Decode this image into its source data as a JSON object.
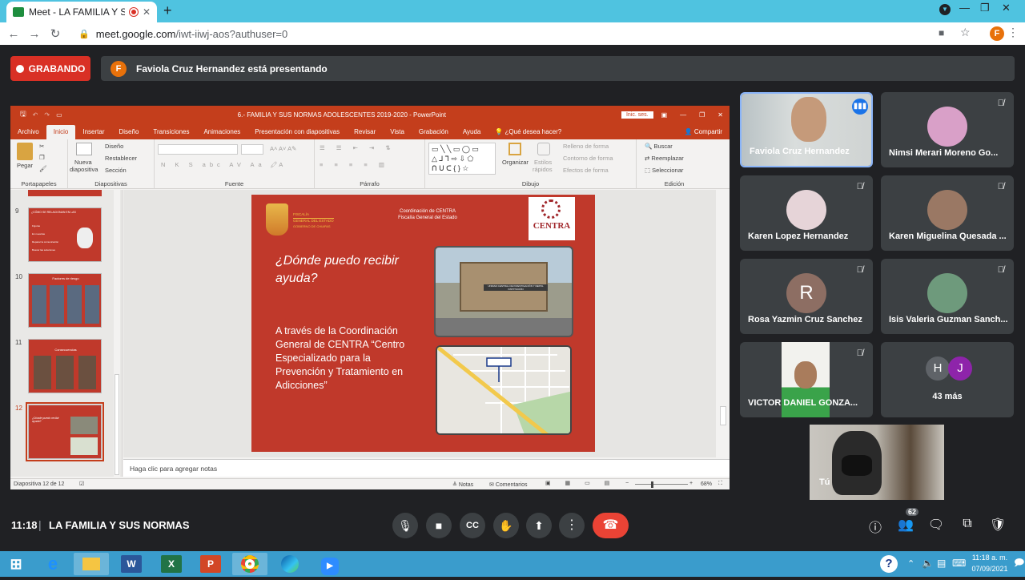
{
  "browser": {
    "tab_title": "Meet - LA FAMILIA Y SUS NO",
    "url_host": "meet.google.com",
    "url_path": "/iwt-iiwj-aos?authuser=0",
    "profile_initial": "F"
  },
  "meet": {
    "recording_label": "GRABANDO",
    "presenter_initial": "F",
    "presenting_text": "Faviola Cruz Hernandez está presentando",
    "time": "11:18",
    "meeting_name": "LA FAMILIA Y SUS NORMAS",
    "participant_count": "62",
    "more_count_label": "43 más",
    "more_initials": [
      "H",
      "J"
    ],
    "self_label": "Tú",
    "participants": [
      {
        "name": "Faviola Cruz Hernandez"
      },
      {
        "name": "Nimsi Merari Moreno Go..."
      },
      {
        "name": "Karen Lopez Hernandez"
      },
      {
        "name": "Karen Miguelina Quesada ..."
      },
      {
        "name": "Rosa Yazmin Cruz Sanchez",
        "initial": "R"
      },
      {
        "name": "Isis Valeria Guzman Sanch..."
      },
      {
        "name": "VICTOR DANIEL GONZA..."
      }
    ]
  },
  "powerpoint": {
    "doc_title": "6.- FAMILIA Y SUS NORMAS ADOLESCENTES 2019-2020  -  PowerPoint",
    "login": "Inic. ses.",
    "tabs": [
      "Archivo",
      "Inicio",
      "Insertar",
      "Diseño",
      "Transiciones",
      "Animaciones",
      "Presentación con diapositivas",
      "Revisar",
      "Vista",
      "Grabación",
      "Ayuda",
      "¿Qué desea hacer?"
    ],
    "share": "Compartir",
    "ribbon": {
      "paste": "Pegar",
      "new_slide_1": "Nueva",
      "new_slide_2": "diapositiva",
      "layout": "Diseño",
      "reset": "Restablecer",
      "section": "Sección",
      "organize": "Organizar",
      "styles_1": "Estilos",
      "styles_2": "rápidos",
      "fill": "Relleno de forma",
      "outline": "Contorno de forma",
      "effects": "Efectos de forma",
      "find": "Buscar",
      "replace": "Reemplazar",
      "select": "Seleccionar",
      "groups": [
        "Portapapeles",
        "Diapositivas",
        "Fuente",
        "Párrafo",
        "Dibujo",
        "Edición"
      ]
    },
    "thumbnails": [
      {
        "num": "9",
        "title": "¿CÓMO SE RELACIONAN EN LAS",
        "items": [
          "Figuras",
          "En nuestras",
          "Reparar la comunicación",
          "Buscar las soluciones"
        ]
      },
      {
        "num": "10",
        "title": "Factores de riesgo"
      },
      {
        "num": "11",
        "title": "Consecuencias"
      },
      {
        "num": "12",
        "title": "¿Dónde puedo recibir ayuda?"
      }
    ],
    "slide": {
      "fiscalia_1": "FISCALÍA",
      "fiscalia_2": "GENERAL DEL ESTADO",
      "fiscalia_3": "GOBIERNO DE CHIAPAS",
      "coord_1": "Coordinación de CENTRA",
      "coord_2": "Fiscalía General del Estado",
      "centra_logo": "CENTRA",
      "heading": "¿Dónde puedo recibir ayuda?",
      "body": "A través de la Coordinación General de CENTRA “Centro Especializado para la Prevención y Tratamiento en Adicciones”",
      "building_sign": "UNIDAD CENTRAL DE INVESTIGACIÓN Y DEPOL INSTITUCIÓN"
    },
    "notes_placeholder": "Haga clic para agregar notas",
    "status_slide": "Diapositiva 12 de 12",
    "status_notes": "Notas",
    "status_comments": "Comentarios",
    "zoom": "68%"
  },
  "taskbar": {
    "time": "11:18 a. m.",
    "date": "07/09/2021"
  }
}
